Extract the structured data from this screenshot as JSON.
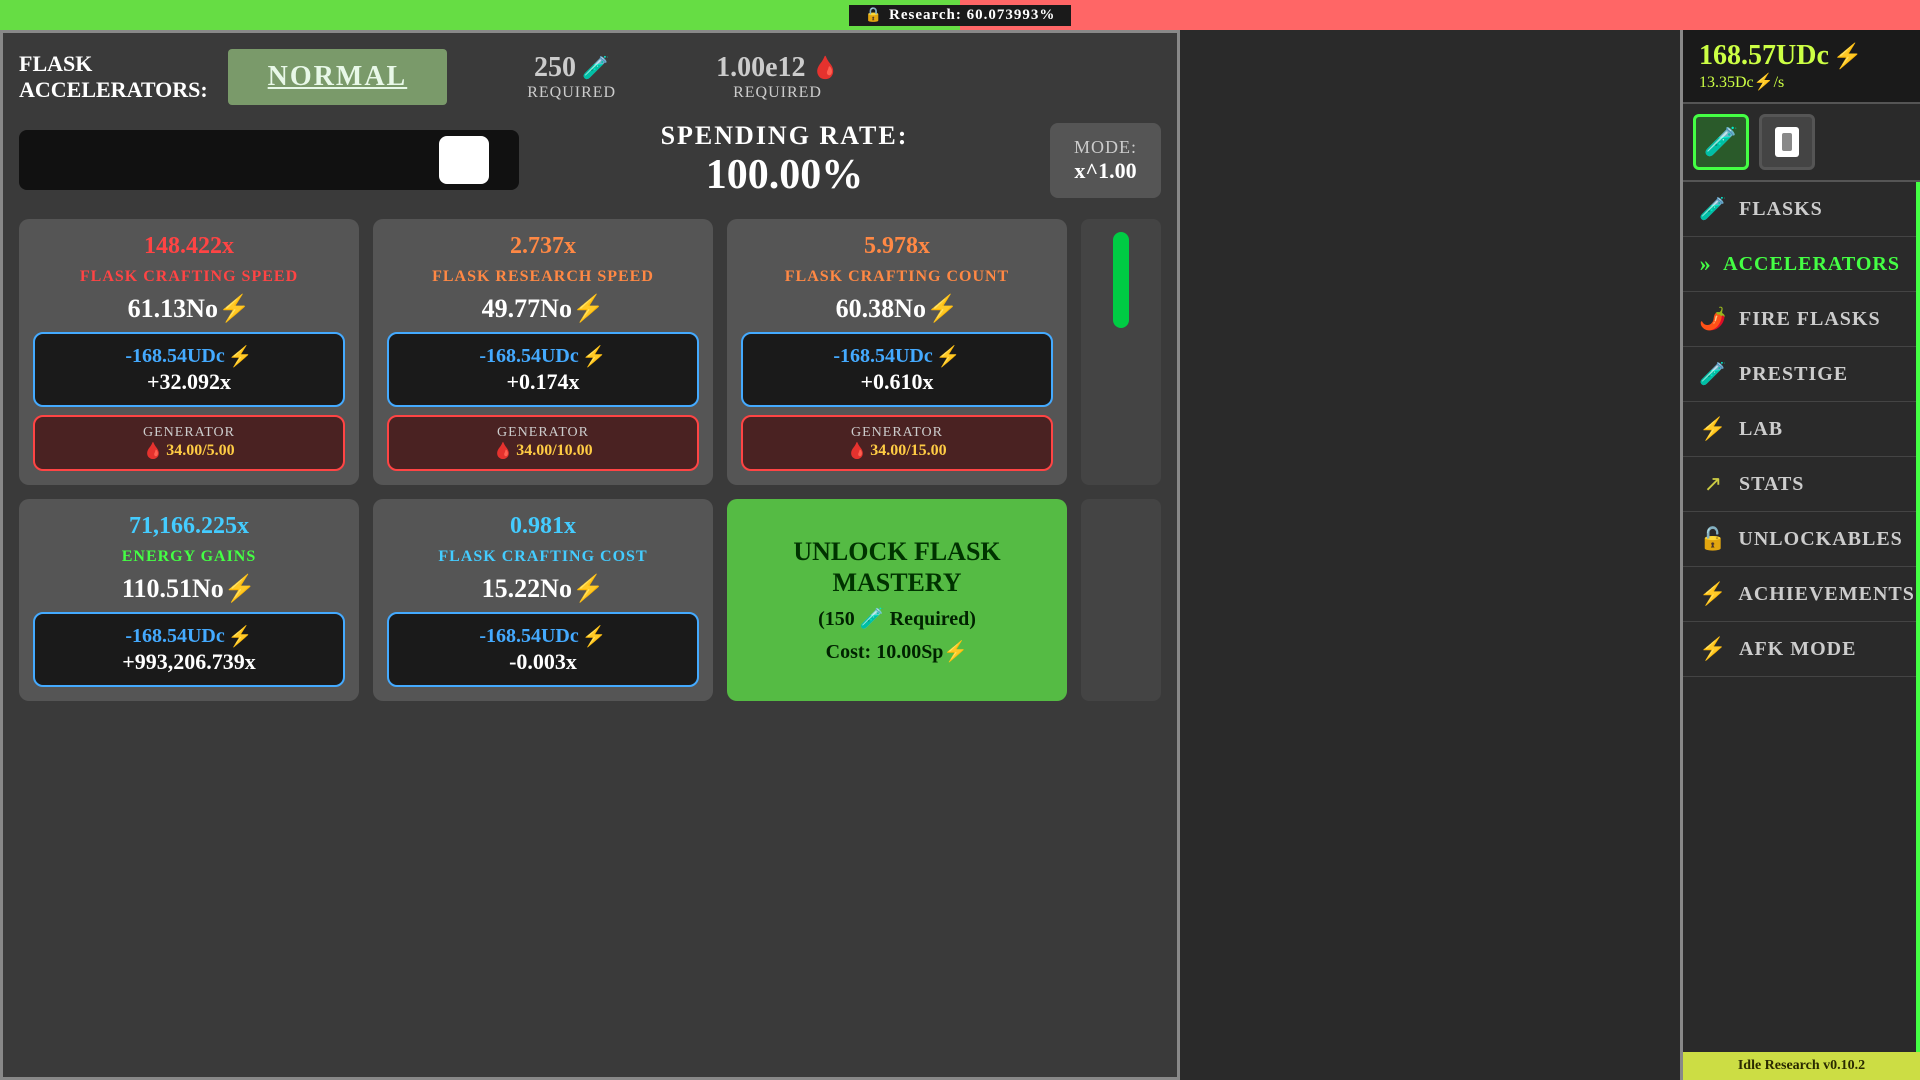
{
  "topbar": {
    "lock_icon": "🔒",
    "research_label": "Research: 60.073993%",
    "progress_pct": 60.07
  },
  "header": {
    "section_line1": "Flask",
    "section_line2": "Accelerators:",
    "mode_button": "Normal",
    "req1_value": "250",
    "req1_icon": "🧪",
    "req1_label": "Required",
    "req2_value": "1.00e12",
    "req2_icon": "🩸",
    "req2_label": "Required"
  },
  "spending": {
    "rate_title": "Spending Rate:",
    "rate_value": "100.00%",
    "mode_label": "Mode:",
    "mode_value": "x^1.00"
  },
  "cards": [
    {
      "id": "flask-crafting-speed",
      "multiplier": "148.422x",
      "multiplier_color": "red",
      "name": "Flask Crafting Speed",
      "name_color": "red",
      "energy": "61.13No⚡",
      "cost_udc": "-168.54UDc⚡",
      "cost_mult": "+32.092x",
      "gen_label": "Generator",
      "gen_icon": "🩸",
      "gen_value": "34.00/5.00"
    },
    {
      "id": "flask-research-speed",
      "multiplier": "2.737x",
      "multiplier_color": "orange",
      "name": "Flask Research Speed",
      "name_color": "orange",
      "energy": "49.77No⚡",
      "cost_udc": "-168.54UDc⚡",
      "cost_mult": "+0.174x",
      "gen_label": "Generator",
      "gen_icon": "🩸",
      "gen_value": "34.00/10.00"
    },
    {
      "id": "flask-crafting-count",
      "multiplier": "5.978x",
      "multiplier_color": "orange",
      "name": "Flask Crafting Count",
      "name_color": "orange",
      "energy": "60.38No⚡",
      "cost_udc": "-168.54UDc⚡",
      "cost_mult": "+0.610x",
      "gen_label": "Generator",
      "gen_icon": "🩸",
      "gen_value": "34.00/15.00"
    },
    {
      "id": "energy-gains",
      "multiplier": "71,166.225x",
      "multiplier_color": "cyan",
      "name": "Energy Gains",
      "name_color": "green",
      "energy": "110.51No⚡",
      "cost_udc": "-168.54UDc⚡",
      "cost_mult": "+993,206.739x",
      "gen_label": null,
      "gen_value": null
    },
    {
      "id": "flask-crafting-cost",
      "multiplier": "0.981x",
      "multiplier_color": "cyan",
      "name": "Flask Crafting Cost",
      "name_color": "cyan",
      "energy": "15.22No⚡",
      "cost_udc": "-168.54UDc⚡",
      "cost_mult": "-0.003x",
      "gen_label": null,
      "gen_value": null
    }
  ],
  "unlock_card": {
    "title": "Unlock Flask Mastery",
    "req": "(150 🧪 Required)",
    "cost_label": "Cost: 10.00Sp⚡"
  },
  "sidebar": {
    "udc_value": "168.57UDc",
    "udc_bolt": "⚡",
    "udc_rate": "13.35Dc⚡/s",
    "icon_tab1": "🧪",
    "icon_tab2": "⬜",
    "nav_items": [
      {
        "id": "flasks",
        "icon": "🧪",
        "label": "Flasks",
        "active": false
      },
      {
        "id": "accelerators",
        "icon": "»",
        "label": "Accelerators",
        "active": true
      },
      {
        "id": "fire-flasks",
        "icon": "🌶",
        "label": "Fire Flasks",
        "active": false
      },
      {
        "id": "prestige",
        "icon": "🧪",
        "label": "Prestige",
        "active": false
      },
      {
        "id": "lab",
        "icon": "⚡",
        "label": "Lab",
        "active": false
      },
      {
        "id": "stats",
        "icon": "📈",
        "label": "Stats",
        "active": false
      },
      {
        "id": "unlockables",
        "icon": "🔓",
        "label": "Unlockables",
        "active": false
      },
      {
        "id": "achievements",
        "icon": "🏆",
        "label": "Achievements",
        "active": false
      },
      {
        "id": "afk-mode",
        "icon": "⚡",
        "label": "AFK Mode",
        "active": false
      }
    ],
    "version": "Idle Research v0.10.2"
  }
}
